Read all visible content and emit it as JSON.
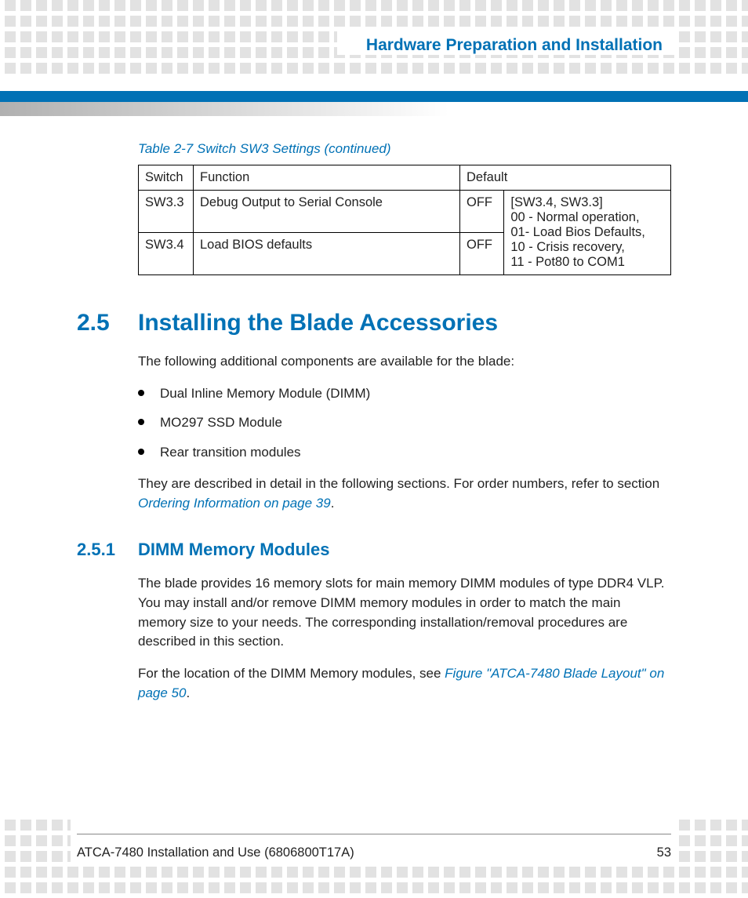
{
  "header": {
    "chapter_title": "Hardware Preparation and Installation"
  },
  "table": {
    "caption": "Table 2-7 Switch SW3 Settings (continued)",
    "headers": {
      "switch": "Switch",
      "function": "Function",
      "default": "Default"
    },
    "rows": [
      {
        "switch": "SW3.3",
        "function": "Debug Output to Serial Console",
        "default": "OFF"
      },
      {
        "switch": "SW3.4",
        "function": "Load BIOS defaults",
        "default": "OFF"
      }
    ],
    "notes": "[SW3.4, SW3.3]\n00 - Normal operation,\n01- Load Bios Defaults,\n10 - Crisis recovery,\n11 - Pot80 to COM1"
  },
  "section": {
    "number": "2.5",
    "title": "Installing the Blade Accessories",
    "intro": "The following additional components are available for the blade:",
    "bullets": [
      "Dual Inline Memory Module (DIMM)",
      "MO297 SSD Module",
      "Rear transition modules"
    ],
    "para2_prefix": "They are described in detail in the following sections. For order numbers, refer to section ",
    "para2_link": "Ordering Information on page 39",
    "para2_suffix": "."
  },
  "subsection": {
    "number": "2.5.1",
    "title": "DIMM Memory Modules",
    "para1": "The blade provides 16 memory slots for main memory DIMM modules of type DDR4 VLP. You may install and/or remove DIMM memory modules in order to match the main memory size to your needs. The corresponding installation/removal procedures are described in this section.",
    "para2_prefix": "For the location of the DIMM Memory modules, see ",
    "para2_link": "Figure \"ATCA-7480 Blade Layout\" on page 50",
    "para2_suffix": "."
  },
  "footer": {
    "doc_title": "ATCA-7480 Installation and Use (6806800T17A)",
    "page_number": "53"
  }
}
